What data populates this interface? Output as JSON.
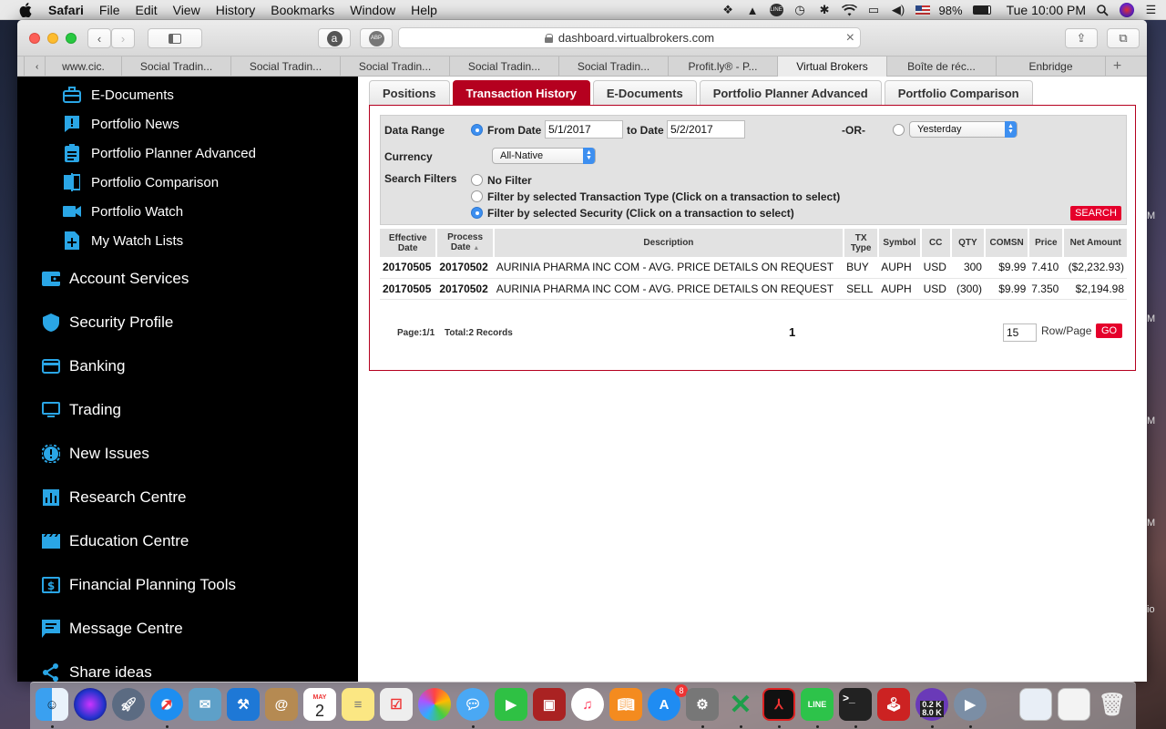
{
  "menubar": {
    "app": "Safari",
    "items": [
      "File",
      "Edit",
      "View",
      "History",
      "Bookmarks",
      "Window",
      "Help"
    ],
    "battery": "98%",
    "clock": "Tue 10:00 PM"
  },
  "browser": {
    "url": "dashboard.virtualbrokers.com",
    "tabs": [
      "",
      "www.cic.",
      "Social Tradin...",
      "Social Tradin...",
      "Social Tradin...",
      "Social Tradin...",
      "Social Tradin...",
      "Profit.ly® - P...",
      "Virtual Brokers",
      "Boîte de réc...",
      "Enbridge"
    ],
    "active_tab_index": 8,
    "new_tab": "+"
  },
  "sidebar": {
    "sub_items": [
      {
        "label": "E-Documents",
        "icon": "briefcase-icon"
      },
      {
        "label": "Portfolio News",
        "icon": "news-alert-icon"
      },
      {
        "label": "Portfolio Planner Advanced",
        "icon": "clipboard-icon"
      },
      {
        "label": "Portfolio Comparison",
        "icon": "compare-icon"
      },
      {
        "label": "Portfolio Watch",
        "icon": "video-icon"
      },
      {
        "label": "My Watch Lists",
        "icon": "add-list-icon"
      }
    ],
    "main_items": [
      {
        "label": "Account Services",
        "icon": "wallet-icon"
      },
      {
        "label": "Security Profile",
        "icon": "shield-icon"
      },
      {
        "label": "Banking",
        "icon": "card-icon"
      },
      {
        "label": "Trading",
        "icon": "monitor-icon"
      },
      {
        "label": "New Issues",
        "icon": "badge-icon"
      },
      {
        "label": "Research Centre",
        "icon": "bar-chart-icon"
      },
      {
        "label": "Education Centre",
        "icon": "film-icon"
      },
      {
        "label": "Financial Planning Tools",
        "icon": "dollar-icon"
      },
      {
        "label": "Message Centre",
        "icon": "message-icon"
      },
      {
        "label": "Share ideas",
        "icon": "share-icon"
      }
    ]
  },
  "page_tabs": [
    "Positions",
    "Transaction History",
    "E-Documents",
    "Portfolio Planner Advanced",
    "Portfolio Comparison"
  ],
  "active_page_tab": 1,
  "filters": {
    "data_range_label": "Data Range",
    "from_label": "From Date",
    "from_value": "5/1/2017",
    "to_label": "to Date",
    "to_value": "5/2/2017",
    "or_label": "-OR-",
    "period_value": "Yesterday",
    "currency_label": "Currency",
    "currency_value": "All-Native",
    "search_filters_label": "Search Filters",
    "options": [
      "No Filter",
      "Filter by selected Transaction Type (Click on a transaction to select)",
      "Filter by selected Security (Click on a transaction to select)"
    ],
    "selected_option": 2,
    "search_button": "SEARCH"
  },
  "table": {
    "headers": [
      "Effective Date",
      "Process Date",
      "Description",
      "TX Type",
      "Symbol",
      "CC",
      "QTY",
      "COMSN",
      "Price",
      "Net Amount"
    ],
    "rows": [
      [
        "20170505",
        "20170502",
        "AURINIA PHARMA INC COM - AVG. PRICE DETAILS ON REQUEST",
        "BUY",
        "AUPH",
        "USD",
        "300",
        "$9.99",
        "7.410",
        "($2,232.93)"
      ],
      [
        "20170505",
        "20170502",
        "AURINIA PHARMA INC COM - AVG. PRICE DETAILS ON REQUEST",
        "SELL",
        "AUPH",
        "USD",
        "(300)",
        "$9.99",
        "7.350",
        "$2,194.98"
      ]
    ]
  },
  "pager": {
    "page_info": "Page:1/1",
    "total": "Total:2 Records",
    "current_page": "1",
    "rows_value": "15",
    "rows_label": "Row/Page",
    "go_button": "GO"
  },
  "dock": {
    "calendar_month": "MAY",
    "calendar_day": "2",
    "appstore_badge": "8",
    "net_up": "0.2 K",
    "net_down": "8.0 K"
  },
  "desktop_edge": [
    "M",
    "M",
    "M",
    "M",
    "io"
  ]
}
